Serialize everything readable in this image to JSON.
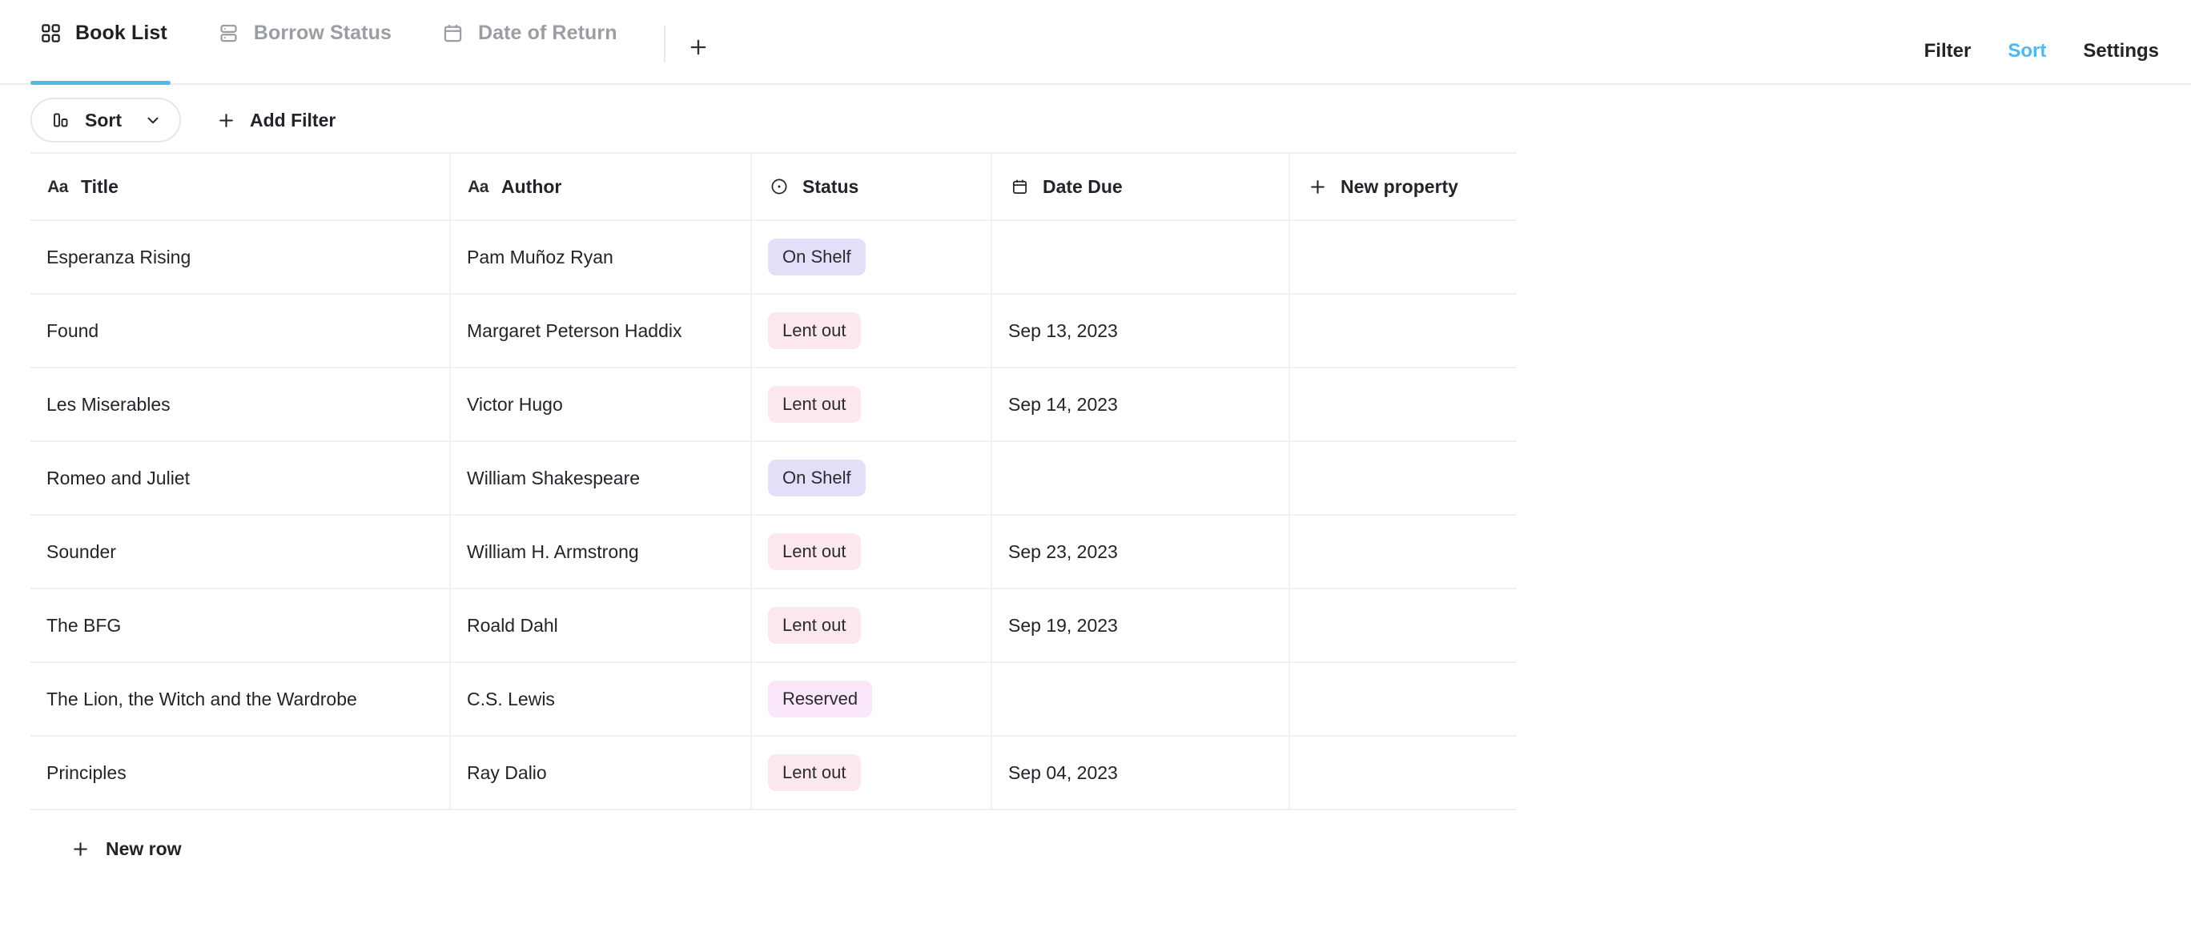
{
  "topbar": {
    "tabs": [
      {
        "label": "Book List",
        "icon": "grid-icon",
        "active": true
      },
      {
        "label": "Borrow Status",
        "icon": "database-icon",
        "active": false
      },
      {
        "label": "Date of Return",
        "icon": "calendar-icon",
        "active": false
      }
    ],
    "add_tab_icon": "plus-icon",
    "actions": [
      {
        "label": "Filter",
        "accent": false
      },
      {
        "label": "Sort",
        "accent": true
      },
      {
        "label": "Settings",
        "accent": false
      }
    ],
    "accent_color": "#4eb8ef"
  },
  "toolbar": {
    "sort_label": "Sort",
    "sort_icon": "bars-icon",
    "sort_chevron_icon": "chevron-down-icon",
    "add_filter_label": "Add Filter",
    "add_filter_icon": "plus-icon"
  },
  "table": {
    "columns": [
      {
        "label": "Title",
        "icon": "text-aa-icon"
      },
      {
        "label": "Author",
        "icon": "text-aa-icon"
      },
      {
        "label": "Status",
        "icon": "select-circle-icon"
      },
      {
        "label": "Date Due",
        "icon": "calendar-icon"
      }
    ],
    "new_property_label": "New property",
    "new_property_icon": "plus-icon",
    "status_colors": {
      "On Shelf": "#e5def8",
      "Lent out": "#fce7ec",
      "Reserved": "#f9e6f8"
    },
    "rows": [
      {
        "title": "Esperanza Rising",
        "author": "Pam Muñoz Ryan",
        "status": "On Shelf",
        "date_due": ""
      },
      {
        "title": "Found",
        "author": "Margaret Peterson Haddix",
        "status": "Lent out",
        "date_due": "Sep 13, 2023"
      },
      {
        "title": "Les Miserables",
        "author": "Victor Hugo",
        "status": "Lent out",
        "date_due": "Sep 14, 2023"
      },
      {
        "title": "Romeo and Juliet",
        "author": "William Shakespeare",
        "status": "On Shelf",
        "date_due": ""
      },
      {
        "title": "Sounder",
        "author": "William H. Armstrong",
        "status": "Lent out",
        "date_due": "Sep 23, 2023"
      },
      {
        "title": "The BFG",
        "author": "Roald Dahl",
        "status": "Lent out",
        "date_due": "Sep 19, 2023"
      },
      {
        "title": "The Lion, the Witch and the Wardrobe",
        "author": "C.S. Lewis",
        "status": "Reserved",
        "date_due": ""
      },
      {
        "title": "Principles",
        "author": "Ray Dalio",
        "status": "Lent out",
        "date_due": "Sep 04, 2023"
      }
    ],
    "new_row_label": "New row",
    "new_row_icon": "plus-icon"
  }
}
